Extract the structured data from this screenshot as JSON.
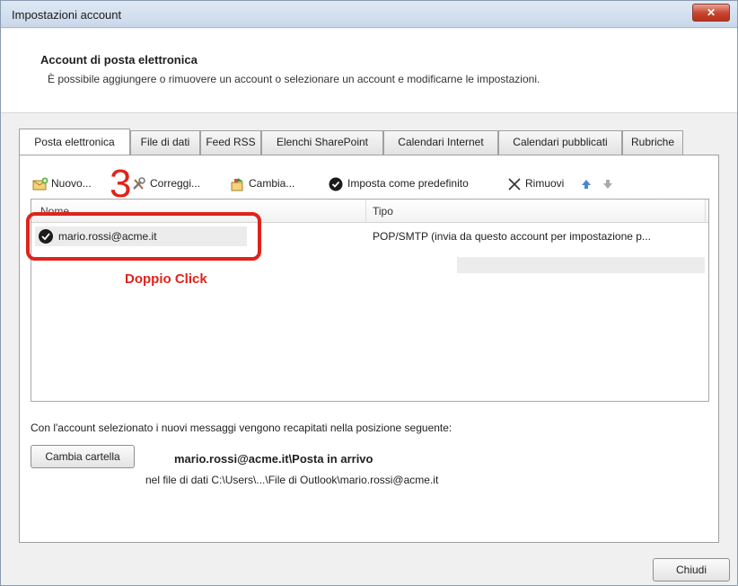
{
  "window": {
    "title": "Impostazioni account",
    "close_glyph": "✕"
  },
  "header": {
    "title": "Account di posta elettronica",
    "subtitle": "È possibile aggiungere o rimuovere un account o selezionare un account e modificarne le impostazioni."
  },
  "tabs": [
    {
      "label": "Posta elettronica",
      "active": true
    },
    {
      "label": "File di dati"
    },
    {
      "label": "Feed RSS"
    },
    {
      "label": "Elenchi SharePoint"
    },
    {
      "label": "Calendari Internet"
    },
    {
      "label": "Calendari pubblicati"
    },
    {
      "label": "Rubriche"
    }
  ],
  "toolbar": {
    "nuovo": "Nuovo...",
    "correggi": "Correggi...",
    "cambia": "Cambia...",
    "imposta": "Imposta come predefinito",
    "rimuovi": "Rimuovi",
    "up_icon": "arrow-up-icon",
    "down_icon": "arrow-down-icon"
  },
  "annotation": {
    "step_number": "3",
    "instruction": "Doppio Click",
    "color": "#e0231c"
  },
  "list": {
    "columns": {
      "name": "Nome",
      "type": "Tipo"
    },
    "rows": [
      {
        "name": "mario.rossi@acme.it",
        "type": "POP/SMTP (invia da questo account per impostazione p..."
      }
    ]
  },
  "delivery": {
    "info": "Con l'account selezionato i nuovi messaggi vengono recapitati nella posizione seguente:",
    "change_folder_button": "Cambia cartella",
    "folder_path": "mario.rossi@acme.it\\Posta in arrivo",
    "data_file": "nel file di dati C:\\Users\\...\\File di Outlook\\mario.rossi@acme.it"
  },
  "footer": {
    "close_button": "Chiudi"
  }
}
